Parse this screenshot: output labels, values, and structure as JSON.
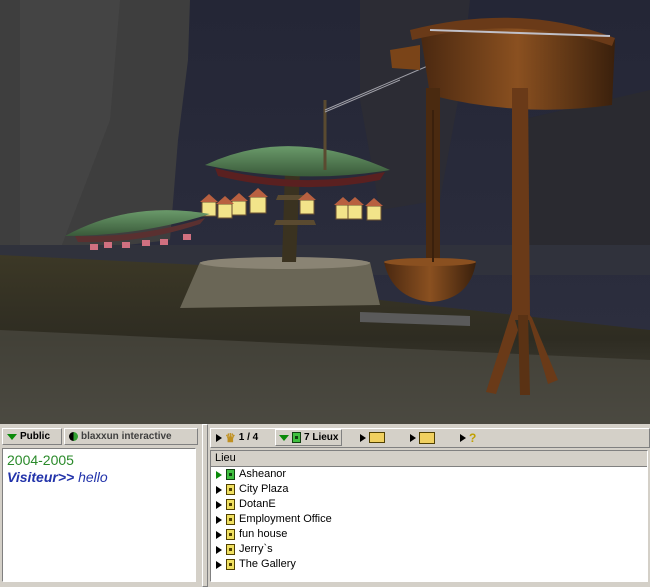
{
  "chat": {
    "tabs": [
      {
        "label": "Public",
        "icon": "chevron-down-icon"
      },
      {
        "label": "blaxxun interactive",
        "icon": "blaxxun-logo-icon"
      }
    ],
    "lines": [
      {
        "type": "year",
        "text": "2004-2005"
      },
      {
        "type": "message",
        "user": "Visiteur>>",
        "text": " hello"
      }
    ]
  },
  "toolbar": {
    "pager": "1 / 4",
    "places_count": "7 Lieux"
  },
  "places": {
    "column_header": "Lieu",
    "items": [
      {
        "name": "Asheanor",
        "active": true
      },
      {
        "name": "City Plaza",
        "active": false
      },
      {
        "name": "DotanE",
        "active": false
      },
      {
        "name": "Employment Office",
        "active": false
      },
      {
        "name": "fun house",
        "active": false
      },
      {
        "name": "Jerry`s",
        "active": false
      },
      {
        "name": "The Gallery",
        "active": false
      }
    ]
  },
  "colors": {
    "chat_year": "#2a8a2a",
    "chat_text": "#2233aa",
    "accent_green": "#0a8a0a"
  }
}
